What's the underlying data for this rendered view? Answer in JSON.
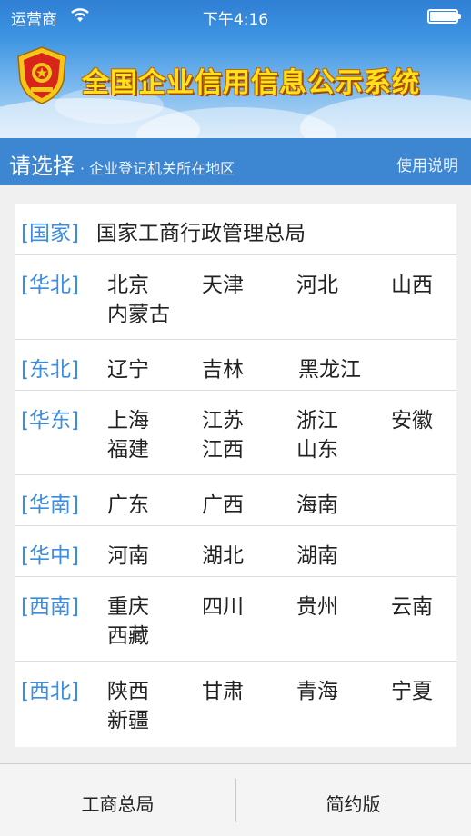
{
  "status": {
    "carrier": "运营商",
    "time": "下午4:16"
  },
  "header": {
    "app_title": "全国企业信用信息公示系统"
  },
  "select_bar": {
    "title": "请选择",
    "subtitle": "· 企业登记机关所在地区",
    "help": "使用说明"
  },
  "national": {
    "tag": "[国家]",
    "link": "国家工商行政管理总局"
  },
  "regions": [
    {
      "tag": "[华北]",
      "provinces": [
        "北京",
        "天津",
        "河北",
        "山西",
        "内蒙古"
      ]
    },
    {
      "tag": "[东北]",
      "provinces": [
        "辽宁",
        "吉林",
        "黑龙江"
      ]
    },
    {
      "tag": "[华东]",
      "provinces": [
        "上海",
        "江苏",
        "浙江",
        "安徽",
        "福建",
        "江西",
        "山东"
      ]
    },
    {
      "tag": "[华南]",
      "provinces": [
        "广东",
        "广西",
        "海南"
      ]
    },
    {
      "tag": "[华中]",
      "provinces": [
        "河南",
        "湖北",
        "湖南"
      ]
    },
    {
      "tag": "[西南]",
      "provinces": [
        "重庆",
        "四川",
        "贵州",
        "云南",
        "西藏"
      ]
    },
    {
      "tag": "[西北]",
      "provinces": [
        "陕西",
        "甘肃",
        "青海",
        "宁夏",
        "新疆"
      ]
    }
  ],
  "tabs": {
    "left": "工商总局",
    "right": "简约版"
  },
  "colors": {
    "accent": "#3d86d1",
    "region_tag": "#3b8de0",
    "title_yellow": "#ffe21a",
    "emblem_red": "#d8251c",
    "emblem_gold": "#f5c518"
  }
}
